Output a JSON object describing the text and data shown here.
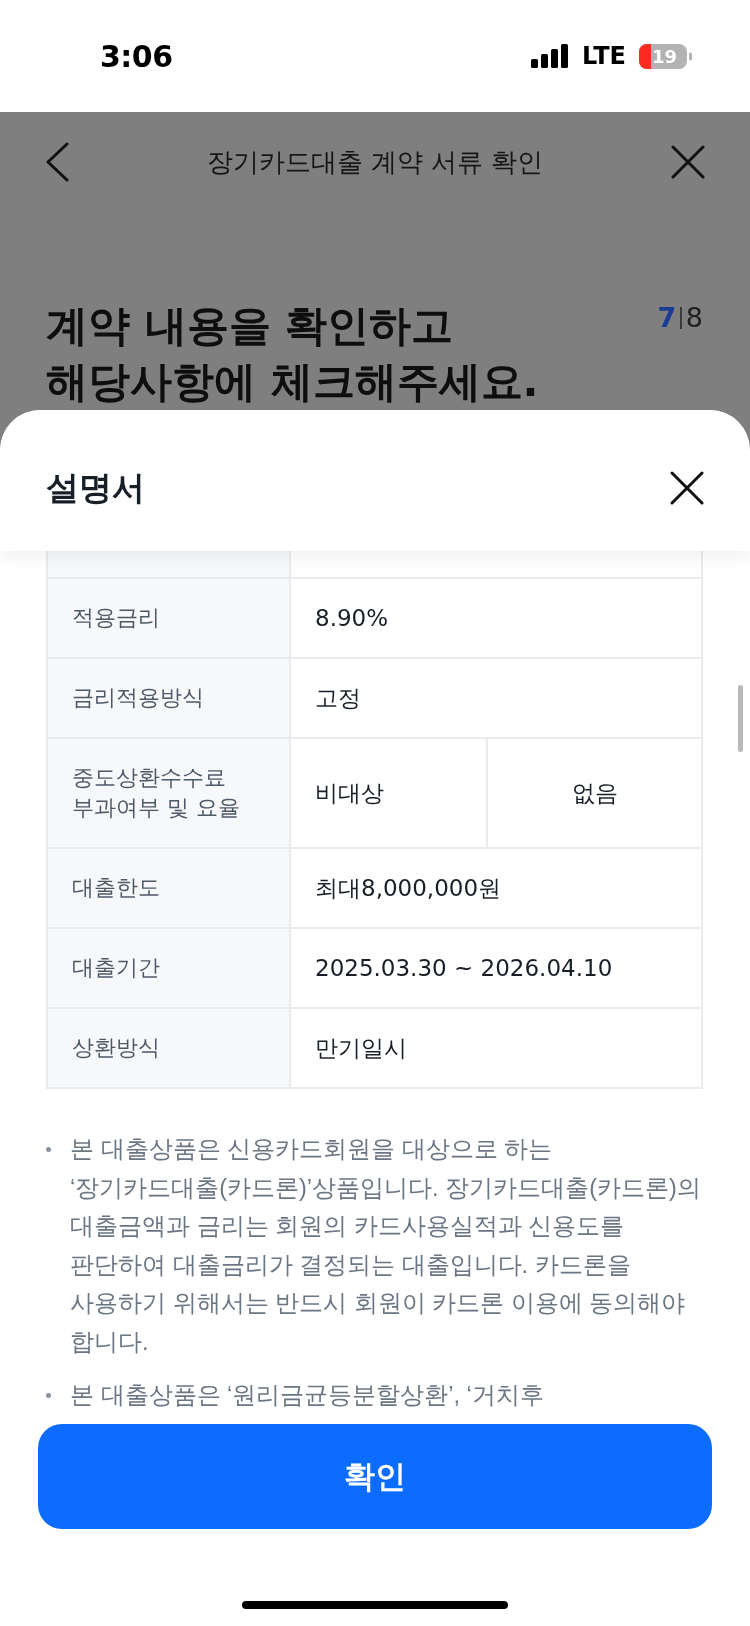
{
  "status_bar": {
    "time": "3:06",
    "network": "LTE",
    "battery": "19"
  },
  "header": {
    "title": "장기카드대출 계약 서류 확인"
  },
  "intro": {
    "heading": "계약 내용을 확인하고\n해당사항에 체크해주세요.",
    "step_current": "7",
    "step_total": "8"
  },
  "sheet": {
    "title": "설명서",
    "table": {
      "rows": [
        {
          "label": "적용금리",
          "values": [
            "8.90%"
          ]
        },
        {
          "label": "금리적용방식",
          "values": [
            "고정"
          ]
        },
        {
          "label": "중도상환수수료 부과여부 및 요율",
          "values": [
            "비대상",
            "없음"
          ]
        },
        {
          "label": "대출한도",
          "values": [
            "최대8,000,000원"
          ]
        },
        {
          "label": "대출기간",
          "values": [
            "2025.03.30 ~ 2026.04.10"
          ]
        },
        {
          "label": "상환방식",
          "values": [
            "만기일시"
          ]
        }
      ]
    },
    "notes": [
      "본 대출상품은 신용카드회원을 대상으로 하는\n‘장기카드대출(카드론)’상품입니다. 장기카드대출(카드론)의\n대출금액과 금리는 회원의 카드사용실적과 신용도를\n판단하여 대출금리가 결정되는 대출입니다. 카드론을\n사용하기 위해서는 반드시 회원이 카드론 이용에 동의해야\n합니다.",
      "본 대출상품은 ‘원리금균등분할상환’, ‘거치후"
    ],
    "confirm_button": "확인"
  }
}
